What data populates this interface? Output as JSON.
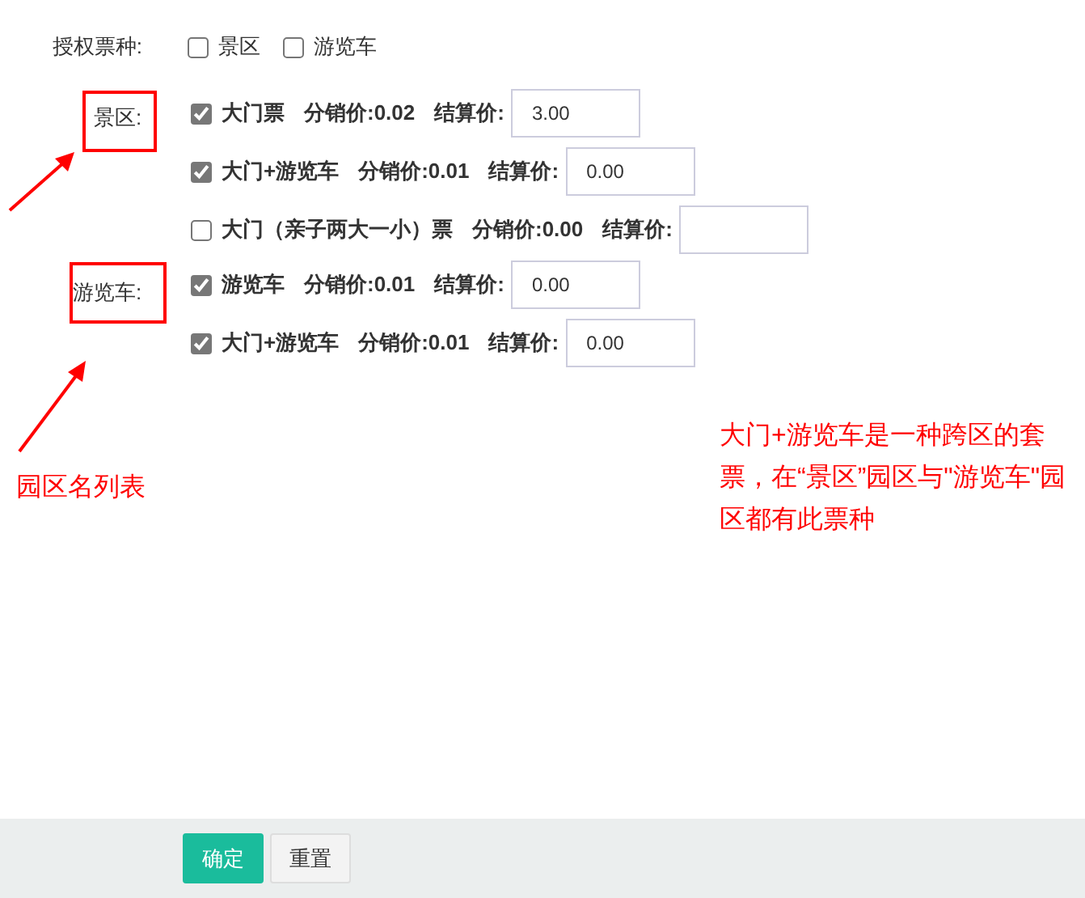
{
  "ticket_types": {
    "label": "授权票种:",
    "options": [
      {
        "label": "景区",
        "checked": false
      },
      {
        "label": "游览车",
        "checked": false
      }
    ]
  },
  "groups": [
    {
      "name": "景区:",
      "tickets": [
        {
          "name": "大门票",
          "checked": true,
          "distribution": "分销价:0.02",
          "settlement_label": "结算价:",
          "settlement": "3.00"
        },
        {
          "name": "大门+游览车",
          "checked": true,
          "distribution": "分销价:0.01",
          "settlement_label": "结算价:",
          "settlement": "0.00"
        },
        {
          "name": "大门（亲子两大一小）票",
          "checked": false,
          "distribution": "分销价:0.00",
          "settlement_label": "结算价:"
        }
      ]
    },
    {
      "name": "游览车:",
      "tickets": [
        {
          "name": "游览车",
          "checked": true,
          "distribution": "分销价:0.01",
          "settlement_label": "结算价:",
          "settlement": "0.00"
        },
        {
          "name": "大门+游览车",
          "checked": true,
          "distribution": "分销价:0.01",
          "settlement_label": "结算价:",
          "settlement": "0.00"
        }
      ]
    }
  ],
  "annotations": {
    "list_note": "园区名列表",
    "combo_note": "大门+游览车是一种跨区的套票，在“景区”园区与\"游览车\"园区都有此票种"
  },
  "buttons": [
    {
      "label": "确定",
      "kind": "primary"
    },
    {
      "label": "重置",
      "kind": "default"
    }
  ]
}
